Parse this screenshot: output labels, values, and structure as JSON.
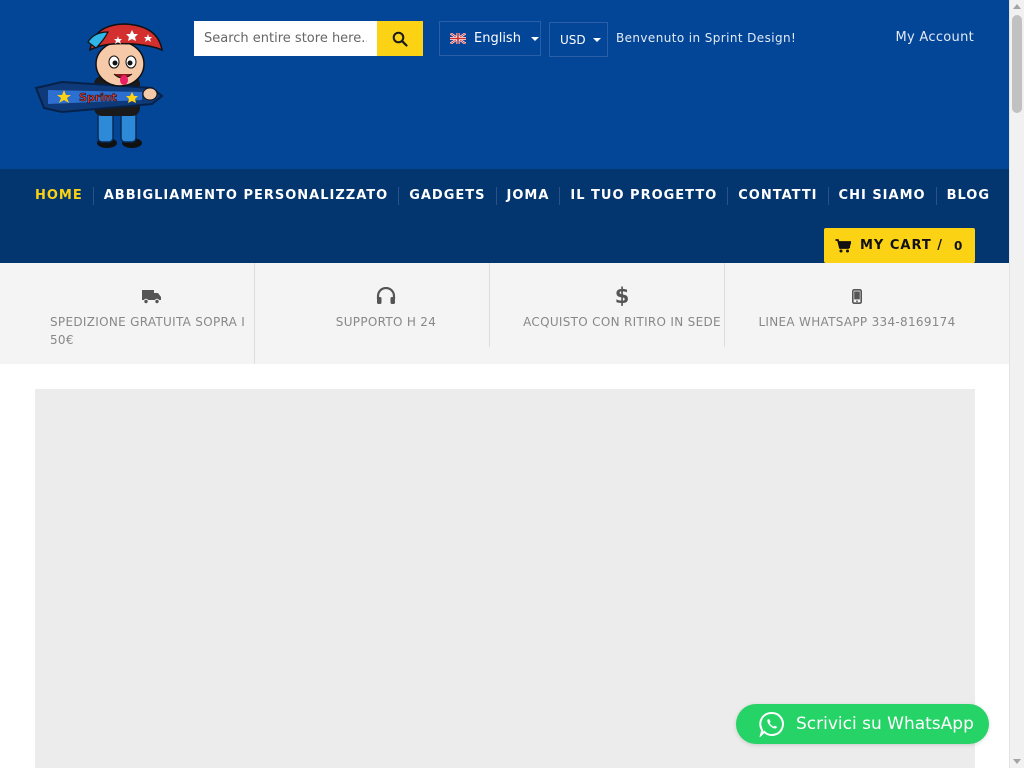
{
  "header": {
    "logo_name": "sprint-design-mascot-logo",
    "search": {
      "placeholder": "Search entire store here...",
      "value": ""
    },
    "language": {
      "selected": "English"
    },
    "currency": {
      "selected": "USD"
    },
    "welcome_text": "Benvenuto in Sprint Design!",
    "account_link": "My Account"
  },
  "nav": {
    "items": [
      {
        "label": "HOME",
        "active": true
      },
      {
        "label": "ABBIGLIAMENTO PERSONALIZZATO",
        "active": false
      },
      {
        "label": "GADGETS",
        "active": false
      },
      {
        "label": "JOMA",
        "active": false
      },
      {
        "label": "IL TUO PROGETTO",
        "active": false
      },
      {
        "label": "CONTATTI",
        "active": false
      },
      {
        "label": "CHI SIAMO",
        "active": false
      },
      {
        "label": "BLOG",
        "active": false
      }
    ],
    "cart": {
      "label": "MY CART /",
      "count": "0"
    }
  },
  "features": [
    {
      "icon": "truck-icon",
      "text": "SPEDIZIONE GRATUITA SOPRA I 50€"
    },
    {
      "icon": "headphones-icon",
      "text": "SUPPORTO H 24"
    },
    {
      "icon": "dollar-icon",
      "text": "ACQUISTO CON RITIRO IN SEDE"
    },
    {
      "icon": "mobile-phone-icon",
      "text": "LINEA WHATSAPP 334-8169174"
    }
  ],
  "whatsapp_button": {
    "label": "Scrivici su WhatsApp"
  },
  "colors": {
    "header_bg": "#034597",
    "nav_bg": "#03356f",
    "accent_yellow": "#fcd215",
    "features_bg": "#f4f4f4",
    "whatsapp_green": "#25d366"
  }
}
